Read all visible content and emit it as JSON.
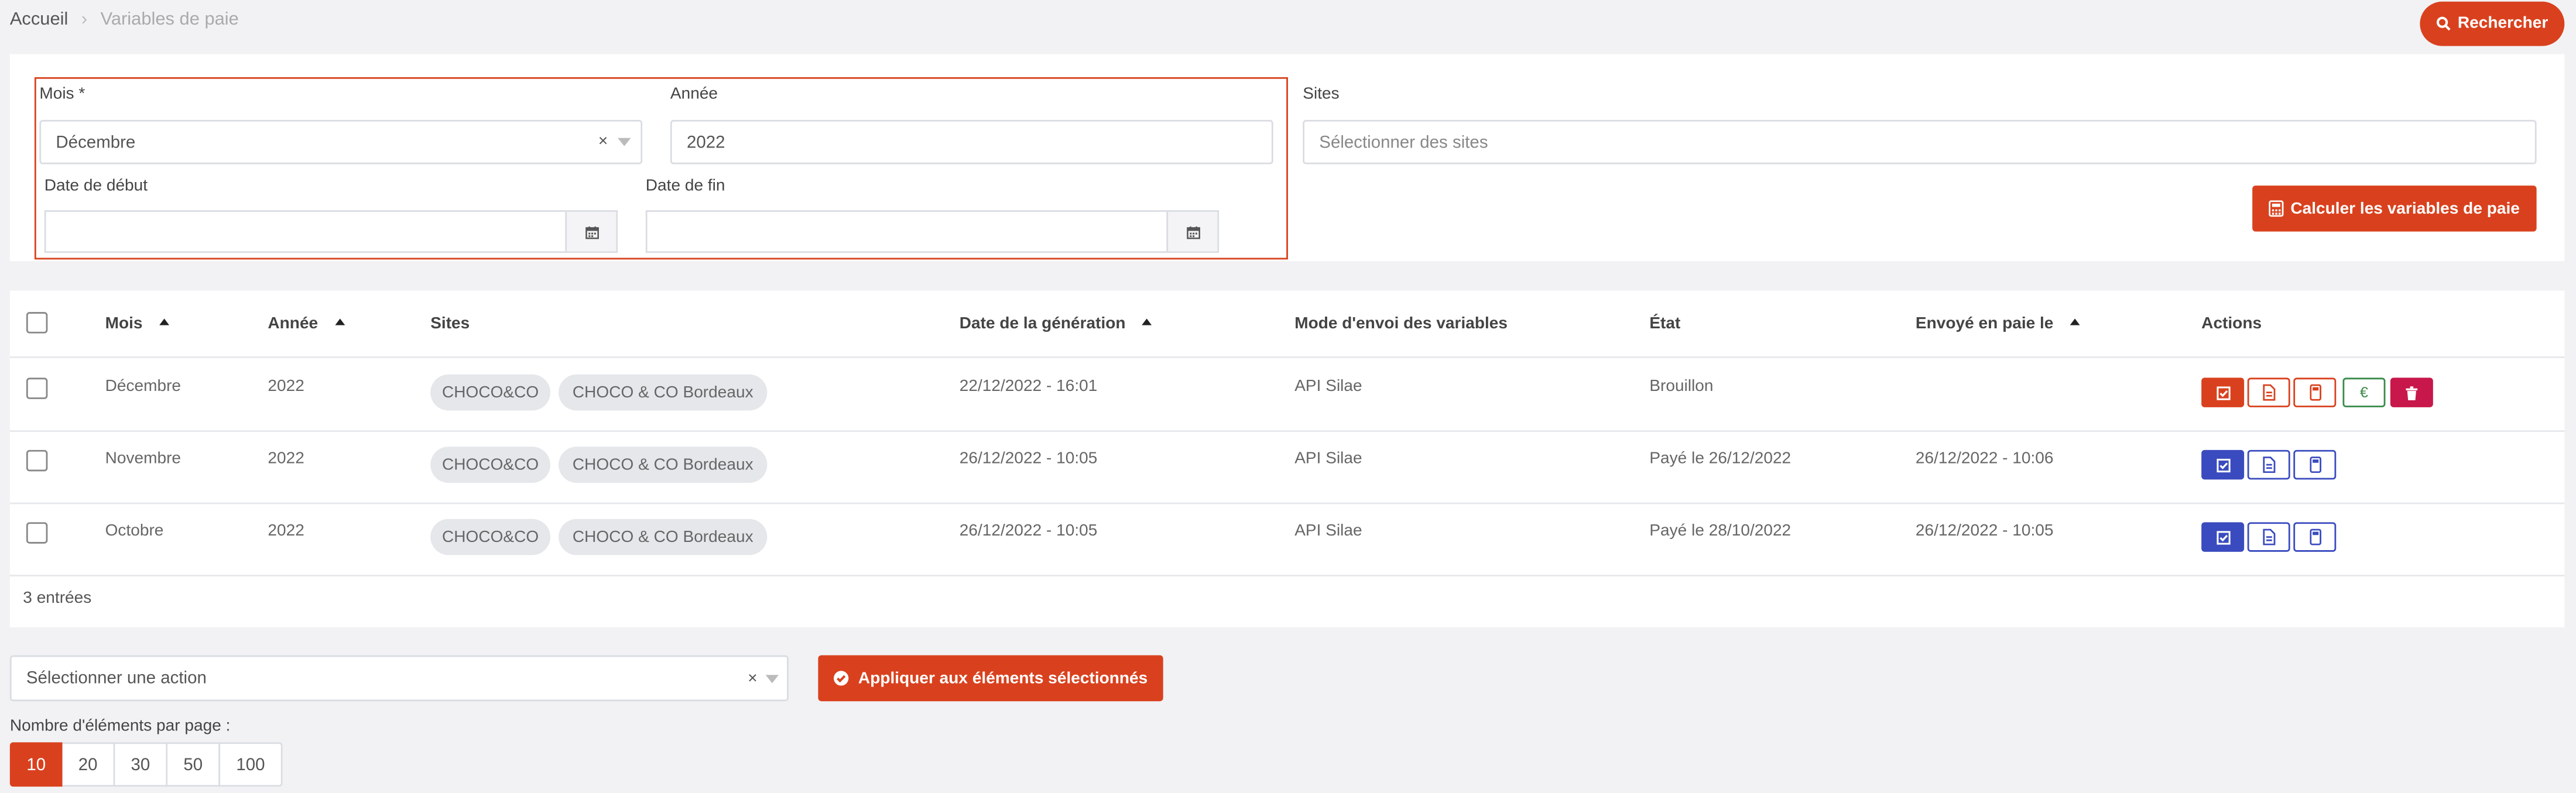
{
  "colors": {
    "accent": "#d9411e",
    "blue": "#3a4bbf",
    "green": "#3a8a4a",
    "crimson": "#c8174a"
  },
  "breadcrumb": {
    "home": "Accueil",
    "separator": "›",
    "current": "Variables de paie"
  },
  "search_button": {
    "label": "Rechercher",
    "icon": "search-icon"
  },
  "filters": {
    "mois": {
      "label": "Mois *",
      "value": "Décembre",
      "clear": "×"
    },
    "annee": {
      "label": "Année",
      "value": "2022"
    },
    "sites": {
      "label": "Sites",
      "placeholder": "Sélectionner des sites"
    },
    "date_debut": {
      "label": "Date de début",
      "value": "",
      "icon": "calendar-icon"
    },
    "date_fin": {
      "label": "Date de fin",
      "value": "",
      "icon": "calendar-icon"
    },
    "calc_button": {
      "label": "Calculer les variables de paie",
      "icon": "calculator-icon"
    }
  },
  "table": {
    "columns": {
      "mois": "Mois",
      "annee": "Année",
      "sites": "Sites",
      "date_generation": "Date de la génération",
      "mode_envoi": "Mode d'envoi des variables",
      "etat": "État",
      "envoye": "Envoyé en paie le",
      "actions": "Actions"
    },
    "rows": [
      {
        "mois": "Décembre",
        "annee": "2022",
        "sites": [
          "CHOCO&CO",
          "CHOCO & CO Bordeaux"
        ],
        "date_generation": "22/12/2022 - 16:01",
        "mode_envoi": "API Silae",
        "etat": "Brouillon",
        "envoye": "",
        "euro": "€"
      },
      {
        "mois": "Novembre",
        "annee": "2022",
        "sites": [
          "CHOCO&CO",
          "CHOCO & CO Bordeaux"
        ],
        "date_generation": "26/12/2022 - 10:05",
        "mode_envoi": "API Silae",
        "etat": "Payé le 26/12/2022",
        "envoye": "26/12/2022 - 10:06"
      },
      {
        "mois": "Octobre",
        "annee": "2022",
        "sites": [
          "CHOCO&CO",
          "CHOCO & CO Bordeaux"
        ],
        "date_generation": "26/12/2022 - 10:05",
        "mode_envoi": "API Silae",
        "etat": "Payé le 28/10/2022",
        "envoye": "26/12/2022 - 10:05"
      }
    ],
    "entries": "3 entrées"
  },
  "bulk": {
    "placeholder": "Sélectionner une action",
    "clear": "×",
    "apply_label": "Appliquer aux éléments sélectionnés"
  },
  "pagination": {
    "label": "Nombre d'éléments par page :",
    "options": [
      "10",
      "20",
      "30",
      "50",
      "100"
    ],
    "selected": "10"
  }
}
